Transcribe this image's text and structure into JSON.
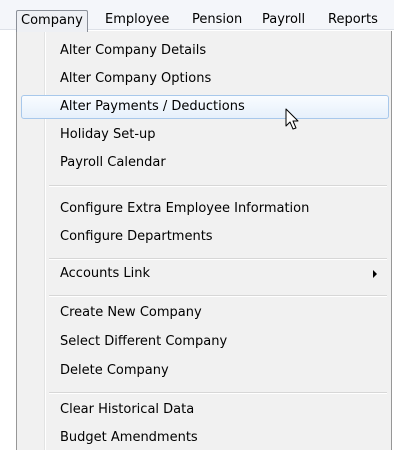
{
  "menubar": {
    "items": [
      {
        "label": "Company",
        "active": true
      },
      {
        "label": "Employee"
      },
      {
        "label": "Pension"
      },
      {
        "label": "Payroll"
      },
      {
        "label": "Reports"
      }
    ]
  },
  "dropdown": {
    "groups": [
      {
        "items": [
          {
            "label": "Alter Company Details"
          },
          {
            "label": "Alter Company Options"
          },
          {
            "label": "Alter Payments / Deductions",
            "highlighted": true
          },
          {
            "label": "Holiday Set-up"
          },
          {
            "label": "Payroll Calendar"
          }
        ]
      },
      {
        "items": [
          {
            "label": "Configure Extra Employee Information"
          },
          {
            "label": "Configure Departments"
          }
        ]
      },
      {
        "items": [
          {
            "label": "Accounts Link",
            "has_submenu": true
          }
        ]
      },
      {
        "items": [
          {
            "label": "Create New Company"
          },
          {
            "label": "Select Different Company"
          },
          {
            "label": "Delete Company"
          }
        ]
      },
      {
        "items": [
          {
            "label": "Clear Historical Data"
          },
          {
            "label": "Budget Amendments"
          }
        ]
      }
    ]
  },
  "icons": {
    "submenu_arrow": "chevron-right-icon",
    "cursor": "mouse-pointer-icon"
  }
}
